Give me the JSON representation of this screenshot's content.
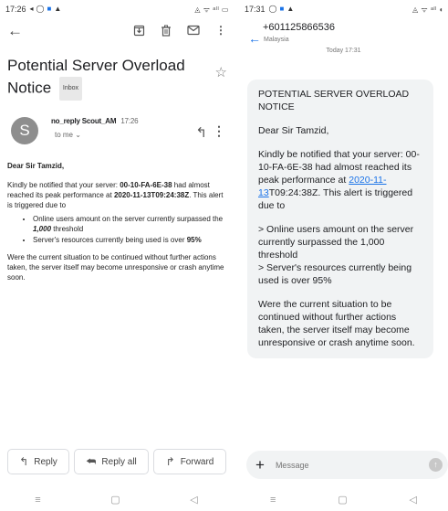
{
  "left": {
    "status": {
      "time": "17:26",
      "icons_left": [
        "◂",
        "◯",
        "■",
        "▲"
      ],
      "right": "◬ ᯤ ᵃˡˡ ▭"
    },
    "toolbar": {
      "back": "←",
      "icons": [
        "archive-icon",
        "delete-icon",
        "mail-icon",
        "more-icon"
      ]
    },
    "subject": "Potential Server Overload Notice",
    "label": "Inbox",
    "sender": {
      "avatar_letter": "S",
      "name": "no_reply Scout_AM",
      "time": "17:26",
      "to": "to me ⌄"
    },
    "body": {
      "greeting": "Dear Sir Tamzid,",
      "p1_a": "Kindly be notified that your server: ",
      "p1_server": "00-10-FA-6E-38",
      "p1_b": " had almost reached its peak performance at ",
      "p1_time": "2020-11-13T09:24:38Z",
      "p1_c": ". This alert is triggered due to",
      "bullet1_a": "Online users amount on the server currently surpassed the ",
      "bullet1_num": "1,000",
      "bullet1_b": " threshold",
      "bullet2_a": "Server's resources currently being used is over ",
      "bullet2_num": "95%",
      "closing": "Were the current situation to be continued without further actions taken, the server itself may become unresponsive or crash anytime soon."
    },
    "buttons": {
      "reply": "Reply",
      "reply_all": "Reply all",
      "forward": "Forward"
    },
    "nav": [
      "≡",
      "▢",
      "◁"
    ]
  },
  "right": {
    "status": {
      "time": "17:31",
      "icons_left": [
        "◯",
        "■",
        "▲"
      ],
      "right": "◬ ᯤ ᵃˡˡ ◐"
    },
    "contact": {
      "number": "+601125866536",
      "country": "Malaysia",
      "date": "Today 17:31"
    },
    "message": {
      "title": "POTENTIAL SERVER OVERLOAD NOTICE",
      "greeting": "Dear Sir Tamzid,",
      "p1_a": "Kindly be notified that your server: 00-10-FA-6E-38 had almost reached its peak performance at ",
      "p1_link": "2020-11-13",
      "p1_b": "T09:24:38Z. This alert is triggered due to",
      "p2_line1": "> Online users amount on the server currently surpassed the 1,000 threshold",
      "p2_line2": "> Server's resources currently being used is over 95%",
      "closing": "Were the current situation to be continued without further actions taken, the server itself may become unresponsive or crash anytime soon."
    },
    "composer": {
      "plus": "+",
      "placeholder": "Message",
      "send": "↑"
    },
    "nav": [
      "≡",
      "▢",
      "◁"
    ]
  }
}
